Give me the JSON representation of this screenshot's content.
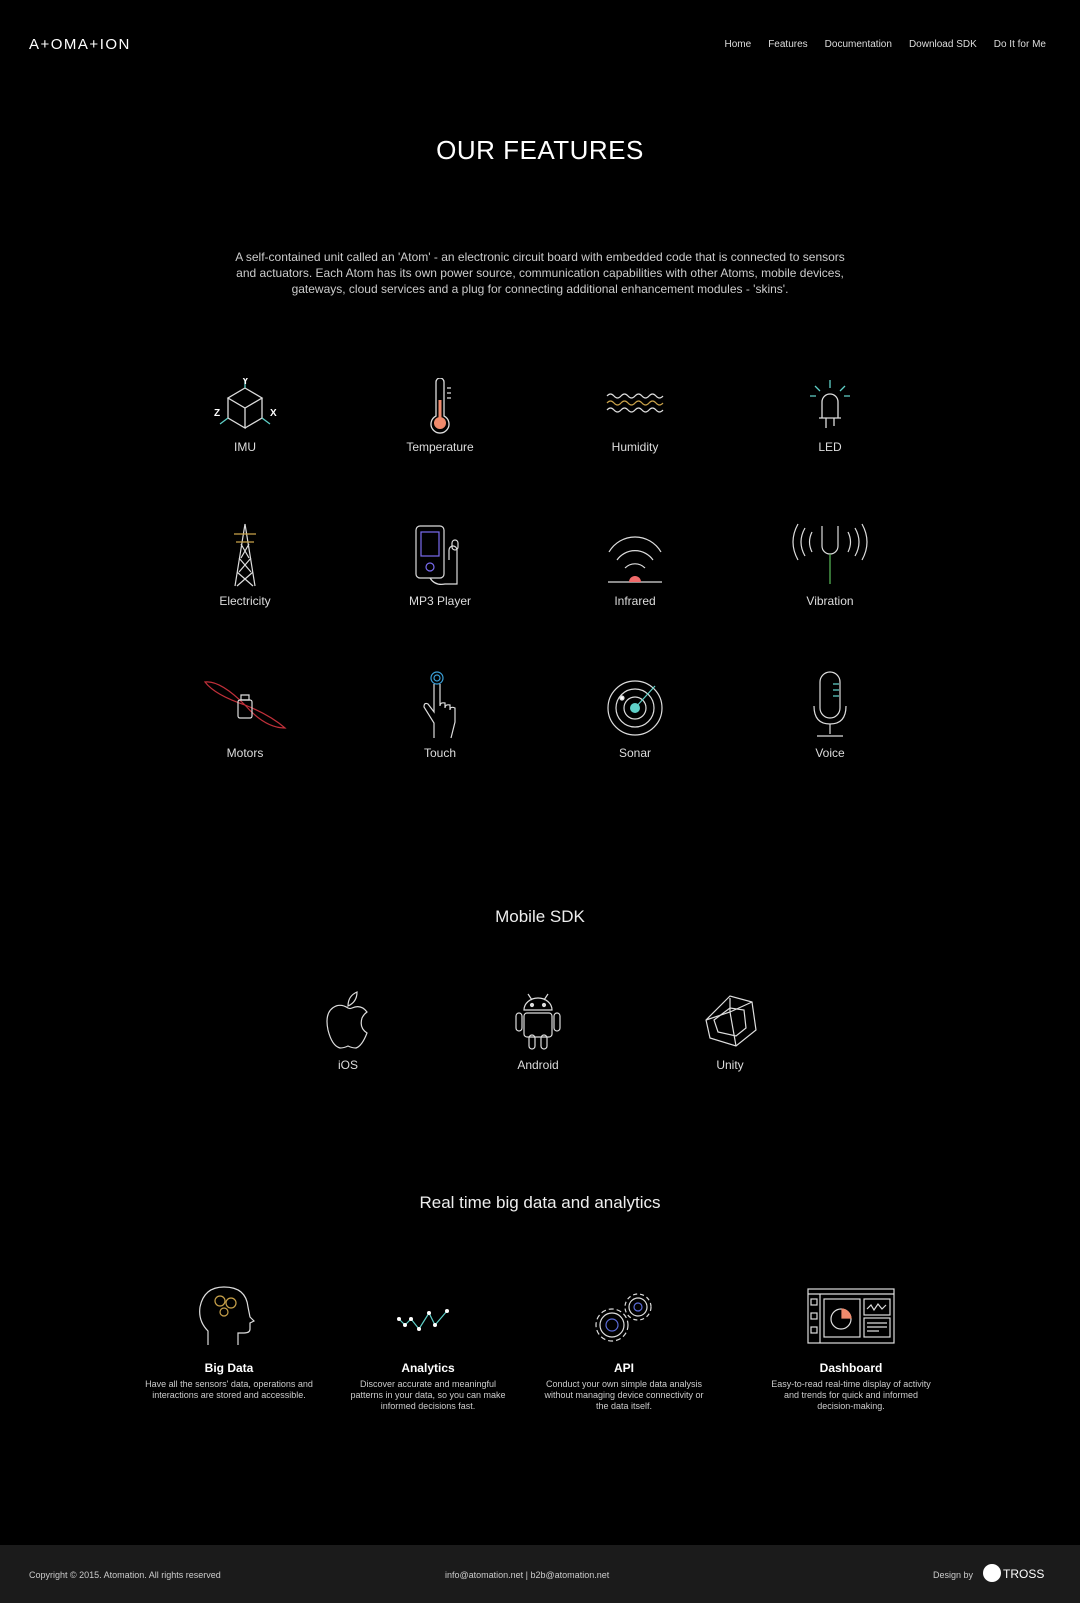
{
  "header": {
    "logo": "A+OMA+ION",
    "nav": [
      "Home",
      "Features",
      "Documentation",
      "Download SDK",
      "Do It for Me"
    ]
  },
  "features": {
    "title": "OUR FEATURES",
    "intro": "A self-contained unit called an 'Atom' - an electronic circuit board with embedded code that is connected to sensors and actuators. Each Atom has its own power source, communication capabilities with other Atoms, mobile devices, gateways, cloud services and a plug for connecting additional enhancement modules - 'skins'.",
    "items": [
      "IMU",
      "Temperature",
      "Humidity",
      "LED",
      "Electricity",
      "MP3 Player",
      "Infrared",
      "Vibration",
      "Motors",
      "Touch",
      "Sonar",
      "Voice"
    ],
    "imu_axes": [
      "Y",
      "Z",
      "X"
    ]
  },
  "sdk": {
    "title": "Mobile SDK",
    "items": [
      "iOS",
      "Android",
      "Unity"
    ]
  },
  "analytics": {
    "title": "Real time big data and analytics",
    "items": [
      {
        "title": "Big Data",
        "desc": "Have all the sensors' data, operations and interactions are stored and accessible."
      },
      {
        "title": "Analytics",
        "desc": "Discover accurate and meaningful patterns in your data, so you can make informed decisions fast."
      },
      {
        "title": "API",
        "desc": "Conduct your own simple data analysis without managing device connectivity or the data itself."
      },
      {
        "title": "Dashboard",
        "desc": "Easy-to-read real-time display of activity and trends for quick and informed decision-making."
      }
    ]
  },
  "footer": {
    "copyright": "Copyright © 2015. Atomation. All rights reserved",
    "emails": "info@atomation.net | b2b@atomation.net",
    "design_by": "Design by",
    "designer": "TROSS"
  },
  "colors": {
    "accent_orange": "#f08a6c",
    "accent_teal": "#5fd0c8",
    "accent_gold": "#c9a24a"
  }
}
